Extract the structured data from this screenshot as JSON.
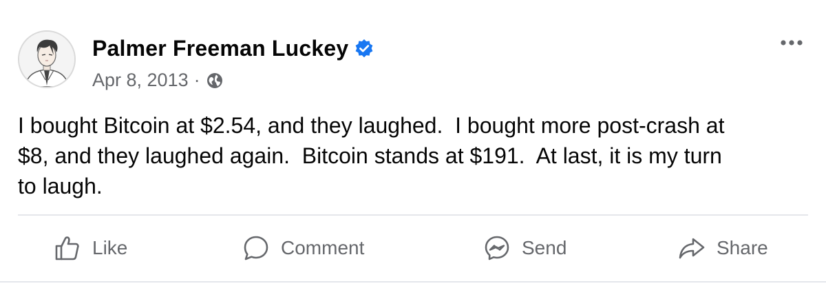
{
  "post": {
    "author": "Palmer Freeman Luckey",
    "date": "Apr 8, 2013",
    "separator": "·",
    "audience_icon": "globe-icon",
    "verified_icon": "verified-badge-icon",
    "more_icon": "more-options-icon",
    "text": "I bought Bitcoin at $2.54, and they laughed.  I bought more post-crash at\n$8, and they laughed again.  Bitcoin stands at $191.  At last, it is my turn\nto laugh."
  },
  "actions": {
    "like": "Like",
    "comment": "Comment",
    "send": "Send",
    "share": "Share"
  },
  "colors": {
    "verified_blue": "#1877f2",
    "secondary_text": "#65676b",
    "divider": "#e4e6eb"
  }
}
